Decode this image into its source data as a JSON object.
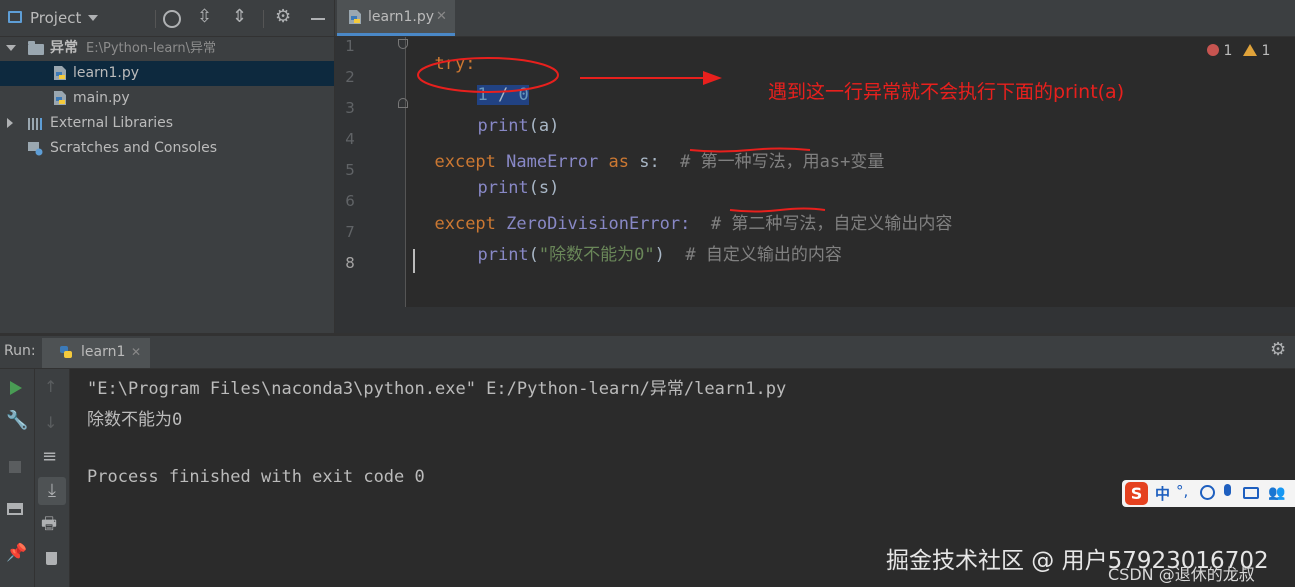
{
  "project_panel": {
    "title": "Project",
    "tree": [
      {
        "label": "异常",
        "path": "E:\\Python-learn\\异常"
      },
      {
        "label": "learn1.py"
      },
      {
        "label": "main.py"
      },
      {
        "label": "External Libraries"
      },
      {
        "label": "Scratches and Consoles"
      }
    ]
  },
  "editor": {
    "tab_label": "learn1.py",
    "line_numbers": [
      "1",
      "2",
      "3",
      "4",
      "5",
      "6",
      "7",
      "8"
    ],
    "lines": {
      "l1": {
        "kw": "try",
        "colon": ":"
      },
      "l2": {
        "a": "1",
        "op": " / ",
        "b": "0"
      },
      "l3": {
        "fn": "print",
        "args": "(a)"
      },
      "l4": {
        "kw": "except",
        "cls": " NameError ",
        "as": "as",
        "var": " s:  ",
        "comment": "# 第一种写法，用as+变量"
      },
      "l5": {
        "fn": "print",
        "args": "(s)"
      },
      "l6": {
        "kw": "except",
        "cls": " ZeroDivisionError:  ",
        "comment": "# 第二种写法，自定义输出内容"
      },
      "l7": {
        "fn": "print",
        "open": "(",
        "str": "\"除数不能为0\"",
        "close": ")  ",
        "comment": "# 自定义输出的内容"
      }
    },
    "inspections": {
      "errors": "1",
      "warnings": "1"
    },
    "annotation": "遇到这一行异常就不会执行下面的print(a)"
  },
  "run_panel": {
    "label": "Run:",
    "tab_label": "learn1",
    "output": [
      "\"E:\\Program Files\\naconda3\\python.exe\" E:/Python-learn/异常/learn1.py",
      "除数不能为0",
      "",
      "Process finished with exit code 0"
    ]
  },
  "overlays": {
    "ime_text": "中",
    "watermark_main": "掘金技术社区 @ 用户57923016702",
    "watermark_sub": "CSDN @退休的龙叔"
  },
  "colors": {
    "keyword": "#cc7832",
    "number": "#6897bb",
    "string": "#6a8759",
    "comment": "#808080",
    "annotation_red": "#e8201d"
  }
}
